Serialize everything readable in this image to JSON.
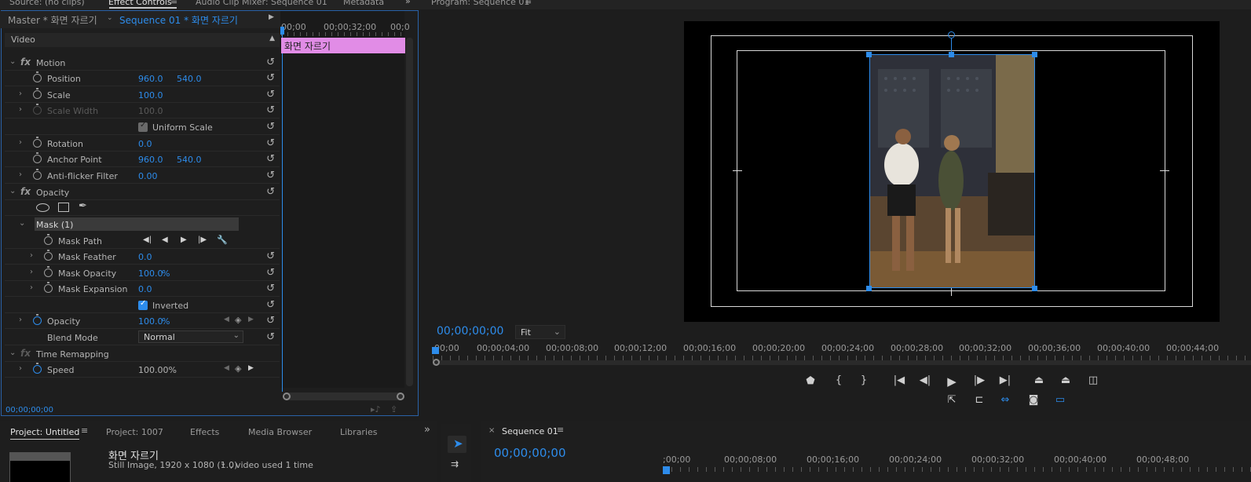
{
  "top_tabs": {
    "source": "Source: (no clips)",
    "effect_controls": "Effect Controls",
    "audio_mixer": "Audio Clip Mixer: Sequence 01",
    "metadata": "Metadata",
    "program": "Program: Sequence 01"
  },
  "effect_controls": {
    "master_label": "Master * 화면 자르기",
    "sequence_label": "Sequence 01 * 화면 자르기",
    "ruler": [
      "00;00",
      "00;00;32;00",
      "00;0"
    ],
    "clip_name": "화면 자르기",
    "video_header": "Video",
    "motion": "Motion",
    "position": {
      "label": "Position",
      "x": "960.0",
      "y": "540.0"
    },
    "scale": {
      "label": "Scale",
      "value": "100.0"
    },
    "scale_width": {
      "label": "Scale Width",
      "value": "100.0"
    },
    "uniform_scale": "Uniform Scale",
    "rotation": {
      "label": "Rotation",
      "value": "0.0"
    },
    "anchor_point": {
      "label": "Anchor Point",
      "x": "960.0",
      "y": "540.0"
    },
    "anti_flicker": {
      "label": "Anti-flicker Filter",
      "value": "0.00"
    },
    "opacity_group": "Opacity",
    "mask": "Mask (1)",
    "mask_path": "Mask Path",
    "mask_feather": {
      "label": "Mask Feather",
      "value": "0.0"
    },
    "mask_opacity": {
      "label": "Mask Opacity",
      "value": "100.0",
      "unit": "%"
    },
    "mask_expansion": {
      "label": "Mask Expansion",
      "value": "0.0"
    },
    "inverted": "Inverted",
    "opacity": {
      "label": "Opacity",
      "value": "100.0",
      "unit": "%"
    },
    "blend_mode": {
      "label": "Blend Mode",
      "value": "Normal"
    },
    "time_remapping": "Time Remapping",
    "speed": {
      "label": "Speed",
      "value": "100.00%"
    },
    "footer_tc": "00;00;00;00"
  },
  "program": {
    "timecode": "00;00;00;00",
    "fit": "Fit",
    "ruler": [
      "00;00",
      "00;00;04;00",
      "00;00;08;00",
      "00;00;12;00",
      "00;00;16;00",
      "00;00;20;00",
      "00;00;24;00",
      "00;00;28;00",
      "00;00;32;00",
      "00;00;36;00",
      "00;00;40;00",
      "00;00;44;00"
    ]
  },
  "project": {
    "tabs": [
      "Project: Untitled",
      "Project: 1007",
      "Effects",
      "Media Browser",
      "Libraries"
    ],
    "item_name": "화면 자르기",
    "item_info": "Still Image, 1920 x 1080 (1.0)",
    "item_usage": ", video used 1 time"
  },
  "sequence": {
    "tab": "Sequence 01",
    "timecode": "00;00;00;00",
    "ruler": [
      ";00;00",
      "00;00;08;00",
      "00;00;16;00",
      "00;00;24;00",
      "00;00;32;00",
      "00;00;40;00",
      "00;00;48;00"
    ]
  }
}
